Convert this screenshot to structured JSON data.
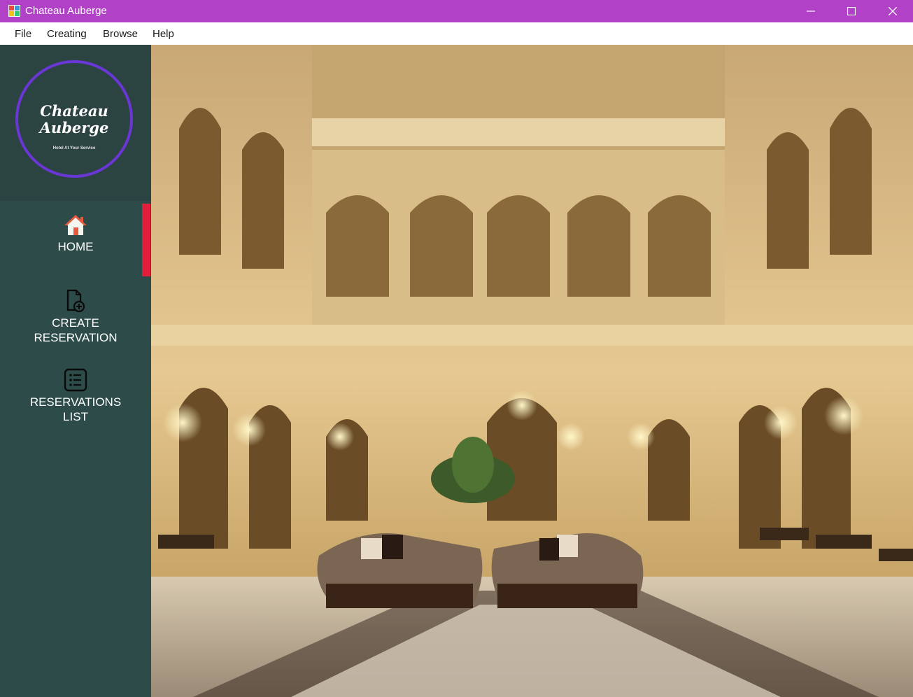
{
  "window": {
    "title": "Chateau Auberge",
    "minimize": "–",
    "maximize": "☐",
    "close": "✕"
  },
  "menu": [
    "File",
    "Creating",
    "Browse",
    "Help"
  ],
  "logo": {
    "line1": "Chateau",
    "line2": "Auberge",
    "tagline": "Hotel At Your Service"
  },
  "nav": {
    "home": "HOME",
    "create_line1": "CREATE",
    "create_line2": "RESERVATION",
    "list_line1": "RESERVATIONS",
    "list_line2": "LIST"
  },
  "colors": {
    "titlebar": "#b141c7",
    "sidebar": "#2c4b49",
    "active_indicator": "#e11e3c",
    "logo_ring": "#6a37d6"
  },
  "icons": {
    "home": "home-icon",
    "create": "file-add-icon",
    "list": "list-icon"
  },
  "hero_image": "hotel lobby photo"
}
